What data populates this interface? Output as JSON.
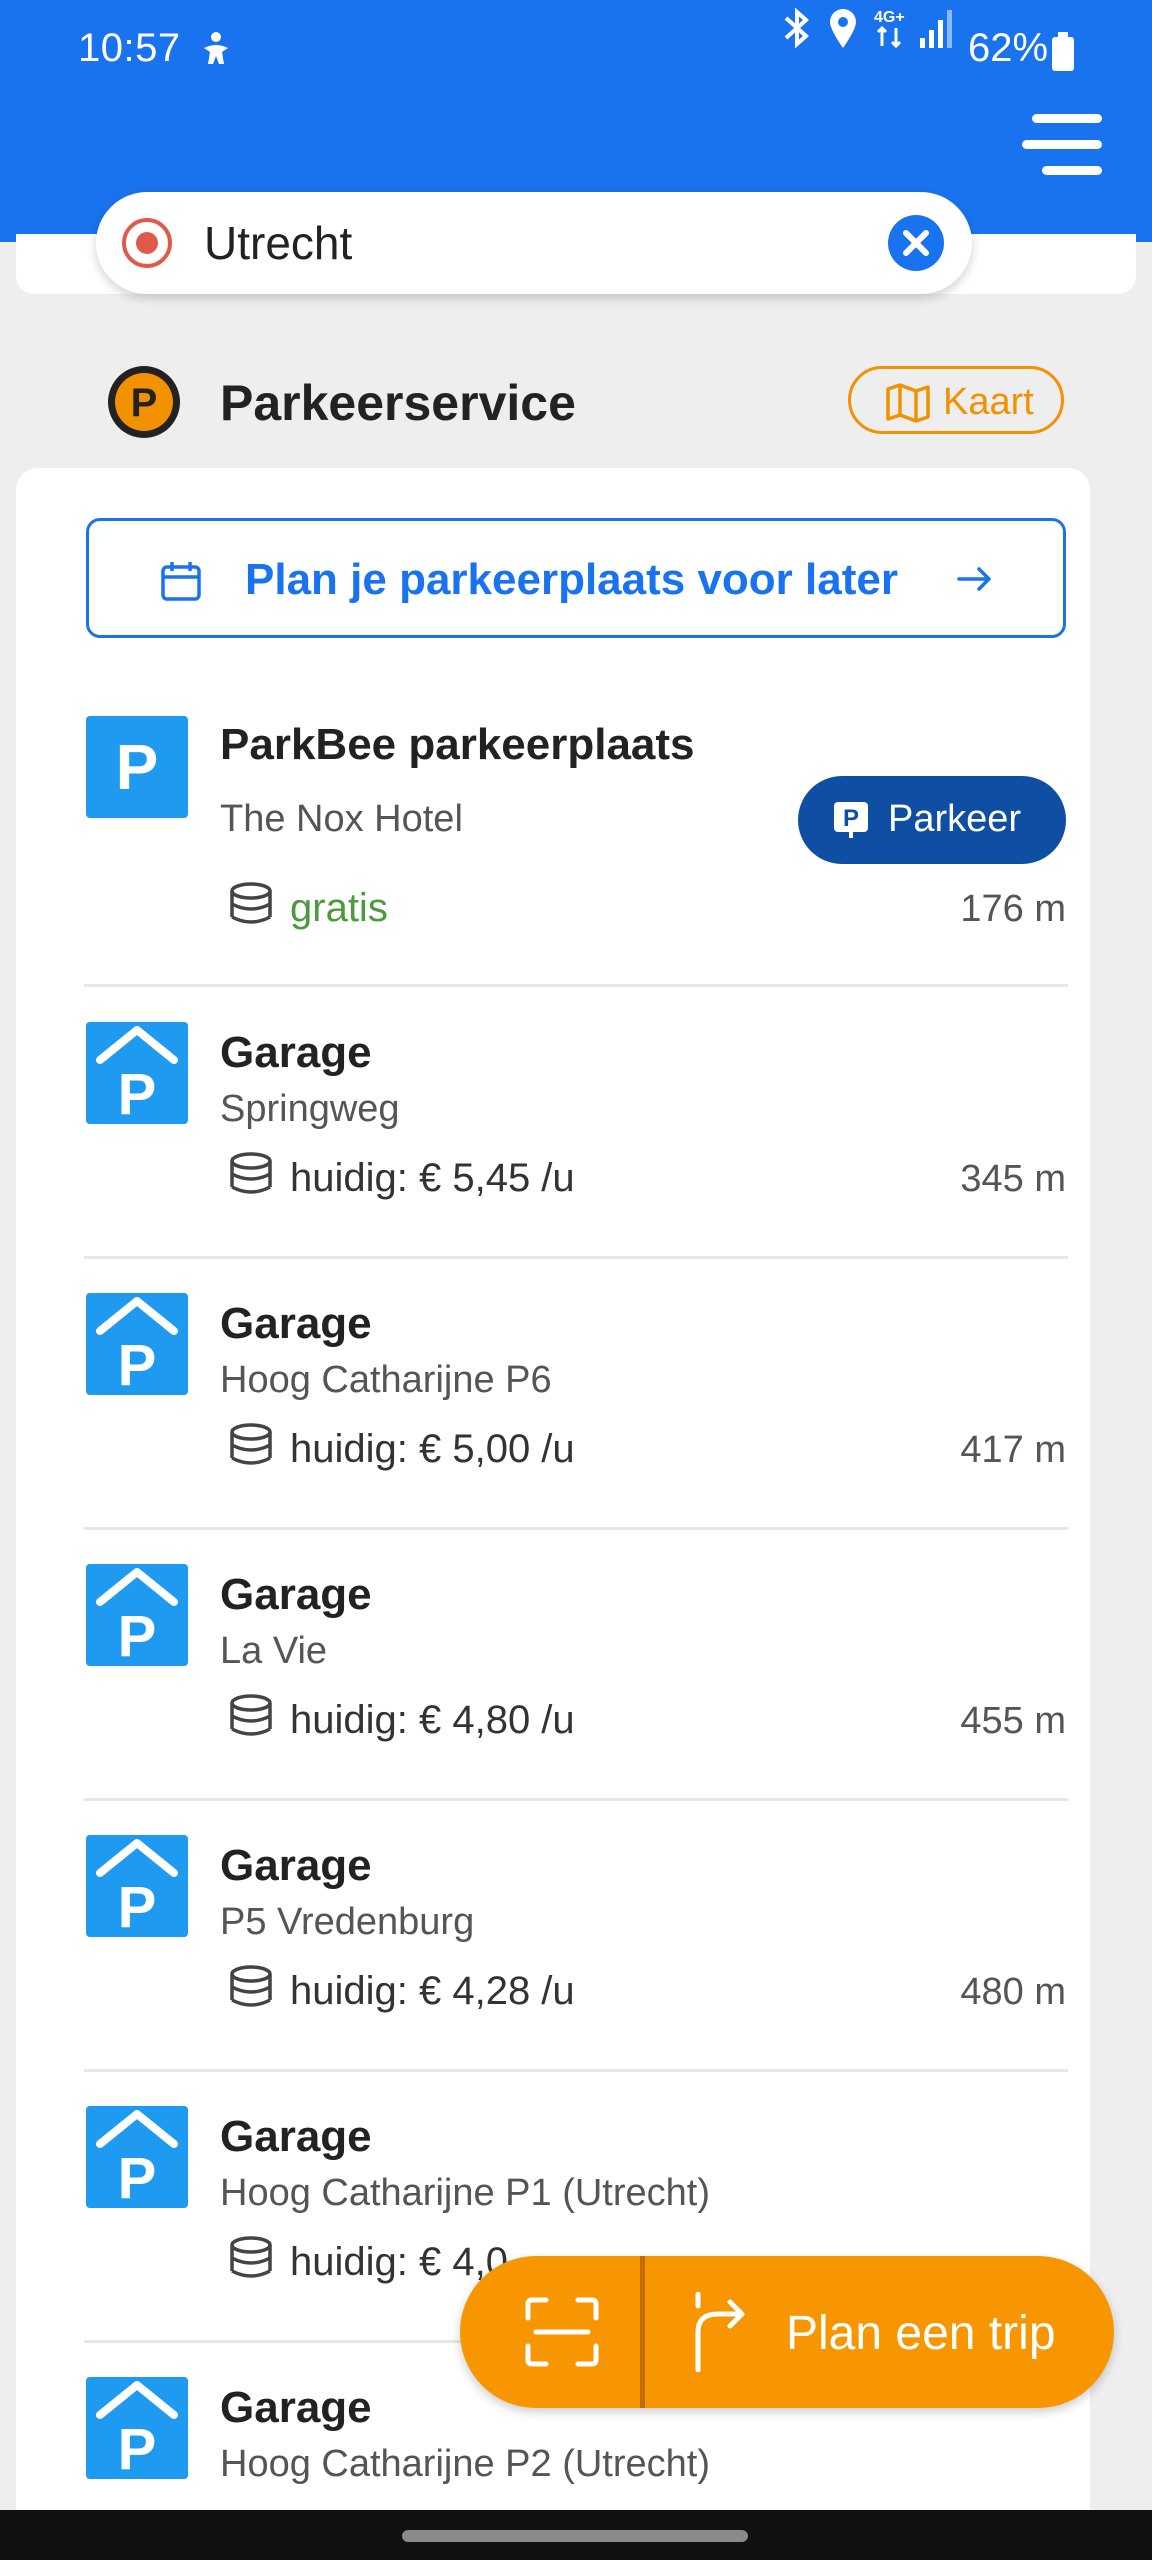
{
  "status_bar": {
    "time": "10:57",
    "battery": "62%"
  },
  "search": {
    "value": "Utrecht"
  },
  "header": {
    "title": "Parkeerservice",
    "map_button": "Kaart"
  },
  "plan_later": {
    "label": "Plan je parkeerplaats voor later"
  },
  "items": [
    {
      "title": "ParkBee parkeerplaats",
      "subtitle": "The Nox Hotel",
      "price": "gratis",
      "distance": "176 m",
      "action": "Parkeer"
    },
    {
      "title": "Garage",
      "subtitle": "Springweg",
      "price": "huidig: € 5,45 /u",
      "distance": "345 m"
    },
    {
      "title": "Garage",
      "subtitle": "Hoog Catharijne P6",
      "price": "huidig: € 5,00 /u",
      "distance": "417 m"
    },
    {
      "title": "Garage",
      "subtitle": "La Vie",
      "price": "huidig: € 4,80 /u",
      "distance": "455 m"
    },
    {
      "title": "Garage",
      "subtitle": "P5 Vredenburg",
      "price": "huidig: € 4,28 /u",
      "distance": "480 m"
    },
    {
      "title": "Garage",
      "subtitle": "Hoog Catharijne P1 (Utrecht)",
      "price": "huidig: € 4,0",
      "distance": ""
    },
    {
      "title": "Garage",
      "subtitle": "Hoog Catharijne P2 (Utrecht)"
    }
  ],
  "fab": {
    "label": "Plan een trip"
  },
  "colors": {
    "primary_blue": "#1a73ee",
    "dark_blue": "#0e4fa3",
    "parking_blue": "#1e9bf0",
    "orange": "#f79600",
    "free_green": "#4a9b3c"
  }
}
